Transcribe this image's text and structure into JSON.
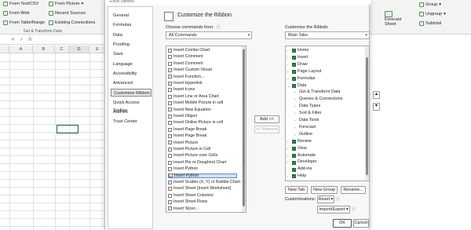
{
  "ribbon": {
    "from_text_csv": "From Text/CSV",
    "from_web": "From Web",
    "from_table_range": "From Table/Range",
    "from_picture": "From Picture",
    "recent_sources": "Recent Sources",
    "existing_connections": "Existing Connections",
    "group_label": "Get & Transform Data",
    "forecast_sheet": "Forecast Sheet",
    "group": "Group",
    "ungroup": "Ungroup",
    "subtotal": "Subtotal"
  },
  "formula_bar": {
    "fx": "fx"
  },
  "columns": [
    "A",
    "B",
    "C",
    "D",
    "E"
  ],
  "dialog": {
    "title": "Excel Options",
    "heading": "Customize the Ribbon.",
    "nav": [
      "General",
      "Formulas",
      "Data",
      "Proofing",
      "Save",
      "Language",
      "Accessibility",
      "Advanced",
      "Customize Ribbon",
      "Quick Access Toolbar",
      "Add-ins",
      "Trust Center"
    ],
    "choose_label": "Choose commands from:",
    "choose_value": "All Commands",
    "customize_label": "Customize the Ribbon:",
    "customize_value": "Main Tabs",
    "commands": [
      "Insert Combo Chart",
      "Insert Comment",
      "Insert Comment",
      "Insert Custom Visual",
      "Insert Function...",
      "Insert Hyperlink",
      "Insert Icons",
      "Insert Line or Area Chart",
      "Insert Mobile Picture in cell",
      "Insert New Equation",
      "Insert Object",
      "Insert Online Picture in cell",
      "Insert Page Break",
      "Insert Page Break",
      "Insert Picture",
      "Insert Picture in Cell",
      "Insert Picture over Cells",
      "Insert Pie or Doughnut Chart",
      "Insert Python",
      "Insert Python",
      "Insert Scatter (X, Y) or Bubble Chart",
      "Insert Sheet [Insert Worksheet]",
      "Insert Sheet Columns",
      "Insert Sheet Rows",
      "Insert Slicer..."
    ],
    "tabs": [
      {
        "label": "Home",
        "level": 0,
        "twisty": ">",
        "checked": true
      },
      {
        "label": "Insert",
        "level": 0,
        "twisty": ">",
        "checked": true
      },
      {
        "label": "Draw",
        "level": 0,
        "twisty": ">",
        "checked": true
      },
      {
        "label": "Page Layout",
        "level": 0,
        "twisty": ">",
        "checked": true
      },
      {
        "label": "Formulas",
        "level": 0,
        "twisty": ">",
        "checked": true
      },
      {
        "label": "Data",
        "level": 0,
        "twisty": "v",
        "checked": true
      },
      {
        "label": "Get & Transform Data",
        "level": 1,
        "twisty": ">",
        "checked": false
      },
      {
        "label": "Queries & Connections",
        "level": 1,
        "twisty": ">",
        "checked": false
      },
      {
        "label": "Data Types",
        "level": 1,
        "twisty": ">",
        "checked": false
      },
      {
        "label": "Sort & Filter",
        "level": 1,
        "twisty": ">",
        "checked": false
      },
      {
        "label": "Data Tools",
        "level": 1,
        "twisty": ">",
        "checked": false
      },
      {
        "label": "Forecast",
        "level": 1,
        "twisty": ">",
        "checked": false
      },
      {
        "label": "Outline",
        "level": 1,
        "twisty": ">",
        "checked": false
      },
      {
        "label": "Review",
        "level": 0,
        "twisty": ">",
        "checked": true
      },
      {
        "label": "View",
        "level": 0,
        "twisty": ">",
        "checked": true
      },
      {
        "label": "Automate",
        "level": 0,
        "twisty": ">",
        "checked": true
      },
      {
        "label": "Developer",
        "level": 0,
        "twisty": ">",
        "checked": true
      },
      {
        "label": "Add-ins",
        "level": 0,
        "twisty": "",
        "checked": true
      },
      {
        "label": "Help",
        "level": 0,
        "twisty": ">",
        "checked": true
      }
    ],
    "add_button": "Add >>",
    "remove_button": "<< Remove",
    "new_tab": "New Tab",
    "new_group": "New Group",
    "rename": "Rename...",
    "customizations_label": "Customizations:",
    "reset": "Reset",
    "import_export": "Import/Export",
    "ok": "OK",
    "cancel": "Cancel"
  },
  "colors": {
    "accent": "#1d6b3a",
    "selection": "#cfe1f4"
  }
}
